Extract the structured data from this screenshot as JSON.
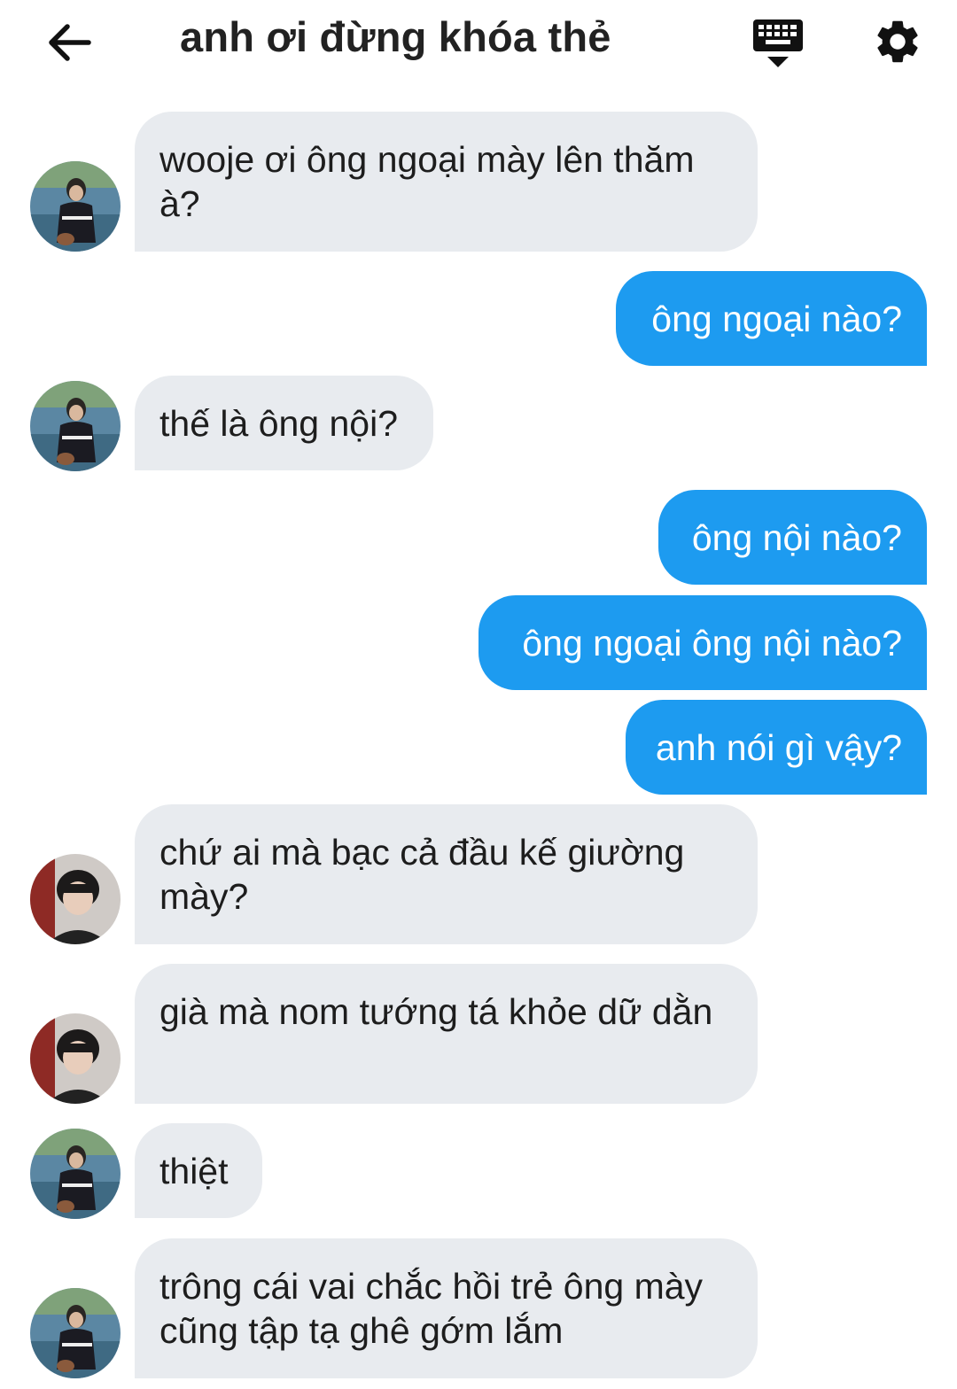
{
  "header": {
    "title": "anh ơi đừng khóa thẻ",
    "back_icon": "arrow-left-icon",
    "keyboard_icon": "keyboard-hide-icon",
    "settings_icon": "gear-icon"
  },
  "colors": {
    "outgoing_bubble": "#1d9bf0",
    "incoming_bubble": "#e8ebef"
  },
  "messages": [
    {
      "side": "in",
      "text": "wooje ơi ông ngoại mày lên thăm à?"
    },
    {
      "side": "out",
      "text": "ông ngoại nào?"
    },
    {
      "side": "in",
      "text": "thế là ông nội?"
    },
    {
      "side": "out",
      "text": "ông nội nào?"
    },
    {
      "side": "out",
      "text": "ông ngoại ông nội nào?"
    },
    {
      "side": "out",
      "text": "anh nói gì vậy?"
    },
    {
      "side": "in",
      "text": "chứ ai mà bạc cả đầu kế giường mày?"
    },
    {
      "side": "in",
      "text": "già mà nom tướng tá khỏe dữ dằn"
    },
    {
      "side": "in",
      "text": "thiệt"
    },
    {
      "side": "in",
      "text": "trông cái vai chắc hồi trẻ ông mày cũng tập tạ ghê gớm lắm"
    }
  ]
}
